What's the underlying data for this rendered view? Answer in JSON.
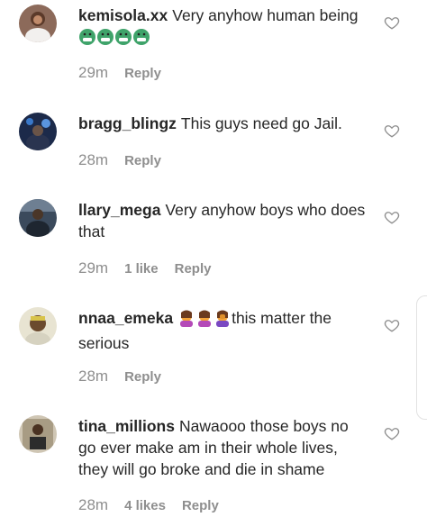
{
  "comments": [
    {
      "username": "kemisola.xx",
      "text": "Very anyhow human being",
      "emojis": [
        "face-with-symbols-icon",
        "face-with-symbols-icon",
        "face-with-symbols-icon",
        "face-with-symbols-icon"
      ],
      "time": "29m",
      "likes": "",
      "reply_label": "Reply"
    },
    {
      "username": "bragg_blingz",
      "text": "This guys need go Jail.",
      "emojis": [],
      "time": "28m",
      "likes": "",
      "reply_label": "Reply"
    },
    {
      "username": "llary_mega",
      "text": "Very anyhow boys who does that",
      "emojis": [],
      "time": "29m",
      "likes": "1 like",
      "reply_label": "Reply"
    },
    {
      "username": "nnaa_emeka",
      "text": "this matter the serious",
      "emojis": [
        "woman-raising-hand-icon",
        "woman-raising-hand-icon",
        "woman-facepalming-icon"
      ],
      "time": "28m",
      "likes": "",
      "reply_label": "Reply"
    },
    {
      "username": "tina_millions",
      "text": "Nawaooo those boys no go ever make am in their whole lives, they will go broke and die in shame",
      "emojis": [],
      "time": "28m",
      "likes": "4 likes",
      "reply_label": "Reply"
    }
  ],
  "colors": {
    "text": "#262626",
    "meta": "#8e8e8e",
    "emoji_green": "#3fa36a",
    "emoji_orange": "#f3a33a"
  }
}
